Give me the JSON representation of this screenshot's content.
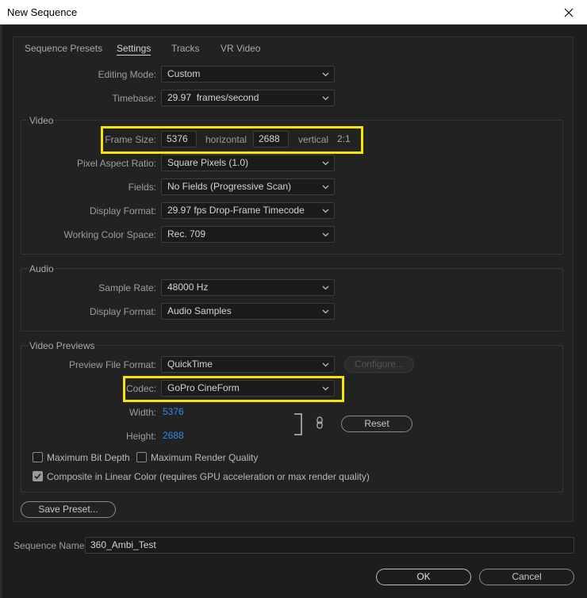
{
  "window": {
    "title": "New Sequence"
  },
  "tabs": [
    "Sequence Presets",
    "Settings",
    "Tracks",
    "VR Video"
  ],
  "settings": {
    "editing_mode": {
      "label": "Editing Mode:",
      "value": "Custom"
    },
    "timebase": {
      "label": "Timebase:",
      "value": "29.97  frames/second"
    }
  },
  "video": {
    "title": "Video",
    "frame_size": {
      "label": "Frame Size:",
      "horizontal": "5376",
      "horizontal_label": "horizontal",
      "vertical": "2688",
      "vertical_label": "vertical",
      "aspect": "2:1"
    },
    "pixel_aspect": {
      "label": "Pixel Aspect Ratio:",
      "value": "Square Pixels (1.0)"
    },
    "fields": {
      "label": "Fields:",
      "value": "No Fields (Progressive Scan)"
    },
    "display_format": {
      "label": "Display Format:",
      "value": "29.97 fps Drop-Frame Timecode"
    },
    "working_color_space": {
      "label": "Working Color Space:",
      "value": "Rec. 709"
    }
  },
  "audio": {
    "title": "Audio",
    "sample_rate": {
      "label": "Sample Rate:",
      "value": "48000 Hz"
    },
    "display_format": {
      "label": "Display Format:",
      "value": "Audio Samples"
    }
  },
  "video_previews": {
    "title": "Video Previews",
    "preview_file_format": {
      "label": "Preview File Format:",
      "value": "QuickTime"
    },
    "configure_label": "Configure...",
    "codec": {
      "label": "Codec:",
      "value": "GoPro CineForm"
    },
    "width": {
      "label": "Width:",
      "value": "5376"
    },
    "height": {
      "label": "Height:",
      "value": "2688"
    },
    "reset_label": "Reset",
    "max_bit_depth": {
      "label": "Maximum Bit Depth",
      "checked": false
    },
    "max_render_quality": {
      "label": "Maximum Render Quality",
      "checked": false
    },
    "composite_linear": {
      "label": "Composite in Linear Color (requires GPU acceleration or max render quality)",
      "checked": true
    }
  },
  "save_preset_label": "Save Preset...",
  "sequence_name": {
    "label": "Sequence Name:",
    "value": "360_Ambi_Test"
  },
  "ok_label": "OK",
  "cancel_label": "Cancel",
  "colors": {
    "highlight": "#f5e600",
    "link_blue": "#2d8ceb",
    "background": "#1d1d1d"
  },
  "icons": {
    "close": "close-icon",
    "chevron": "chevron-down-icon",
    "link": "link-chain-icon"
  }
}
